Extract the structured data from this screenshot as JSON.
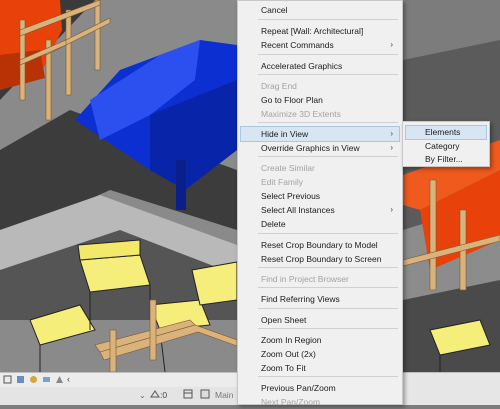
{
  "context_menu": {
    "items": [
      {
        "label": "Cancel",
        "disabled": false,
        "submenu": false
      },
      {
        "label": "Repeat [Wall: Architectural]",
        "disabled": false,
        "submenu": false
      },
      {
        "label": "Recent Commands",
        "disabled": false,
        "submenu": true
      },
      {
        "label": "Accelerated Graphics",
        "disabled": false,
        "submenu": false
      },
      {
        "label": "Drag End",
        "disabled": true,
        "submenu": false
      },
      {
        "label": "Go to Floor Plan",
        "disabled": false,
        "submenu": false
      },
      {
        "label": "Maximize 3D Extents",
        "disabled": true,
        "submenu": false
      },
      {
        "label": "Hide in View",
        "disabled": false,
        "submenu": true,
        "highlighted": true
      },
      {
        "label": "Override Graphics in View",
        "disabled": false,
        "submenu": true
      },
      {
        "label": "Create Similar",
        "disabled": true,
        "submenu": false
      },
      {
        "label": "Edit Family",
        "disabled": true,
        "submenu": false
      },
      {
        "label": "Select Previous",
        "disabled": false,
        "submenu": false
      },
      {
        "label": "Select All Instances",
        "disabled": false,
        "submenu": true
      },
      {
        "label": "Delete",
        "disabled": false,
        "submenu": false
      },
      {
        "label": "Reset Crop Boundary to Model",
        "disabled": false,
        "submenu": false
      },
      {
        "label": "Reset Crop Boundary to Screen",
        "disabled": false,
        "submenu": false
      },
      {
        "label": "Find in Project Browser",
        "disabled": true,
        "submenu": false
      },
      {
        "label": "Find Referring Views",
        "disabled": false,
        "submenu": false
      },
      {
        "label": "Open Sheet",
        "disabled": false,
        "submenu": false
      },
      {
        "label": "Zoom In Region",
        "disabled": false,
        "submenu": false
      },
      {
        "label": "Zoom Out (2x)",
        "disabled": false,
        "submenu": false
      },
      {
        "label": "Zoom To Fit",
        "disabled": false,
        "submenu": false
      },
      {
        "label": "Previous Pan/Zoom",
        "disabled": false,
        "submenu": false
      },
      {
        "label": "Next Pan/Zoom",
        "disabled": true,
        "submenu": false
      }
    ],
    "arrow_glyph": "›"
  },
  "submenu": {
    "items": [
      {
        "label": "Elements",
        "highlighted": true
      },
      {
        "label": "Category"
      },
      {
        "label": "By Filter..."
      }
    ]
  },
  "status_bar": {
    "count": ":0",
    "workset": "Main"
  },
  "colors": {
    "menu_bg": "#f0f0f0",
    "highlight": "#d8e6f4",
    "disabled_text": "#a2a2a2",
    "sofa_orange": "#e8410a",
    "sofa_blue": "#0b2fd1",
    "chair_yellow": "#f6ee7a",
    "wood": "#d9b27c"
  }
}
